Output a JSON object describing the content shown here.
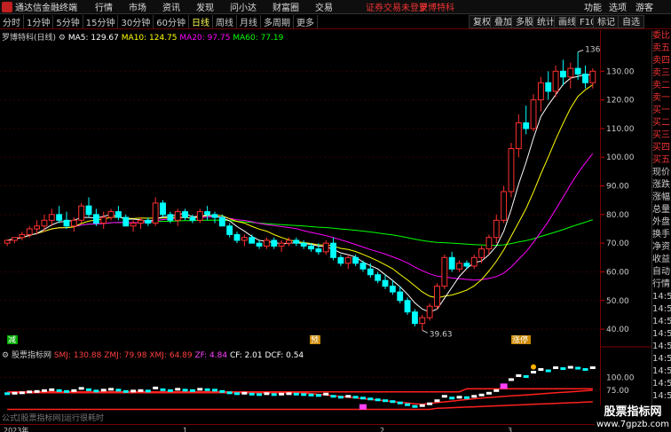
{
  "topbar": {
    "app_title": "通达信金融终端",
    "menus": [
      "行情",
      "市场",
      "资讯",
      "发现",
      "问小达",
      "财富圈",
      "交易"
    ],
    "notice": "证券交易未登录",
    "stock": "罗博特科",
    "right_menus": [
      "功能",
      "选项",
      "游客"
    ]
  },
  "periodbar": {
    "periods": [
      "分时",
      "1分钟",
      "5分钟",
      "15分钟",
      "30分钟",
      "60分钟",
      "日线",
      "周线",
      "月线",
      "多周期",
      "更多"
    ],
    "active": "日线",
    "tools": [
      "复权",
      "叠加",
      "多股",
      "统计",
      "画线",
      "F10",
      "标记",
      "自选"
    ]
  },
  "main_legend": {
    "title": "罗博特科(日线)",
    "ma5": "MA5: 129.67",
    "ma10": "MA10: 124.75",
    "ma20": "MA20: 97.75",
    "ma60": "MA60: 77.19",
    "colors": {
      "ma5": "#ffffff",
      "ma10": "#ffff00",
      "ma20": "#ff00ff",
      "ma60": "#00ff00",
      "up": "#ff3030",
      "down": "#00ffff"
    }
  },
  "main_annotations": {
    "high": "136.75",
    "low": "39.63",
    "markers": [
      "减",
      "预",
      "涨停"
    ]
  },
  "price_axis": [
    "130.00",
    "120.00",
    "110.00",
    "100.00",
    "90.00",
    "80.00",
    "70.00",
    "60.00",
    "50.00",
    "40.00"
  ],
  "ind_legend": {
    "title": "股票指标网",
    "smj": "SMJ: 130.88",
    "zmj": "ZMJ: 79.98",
    "xmj": "XMJ: 64.89",
    "zf": "ZF: 4.84",
    "cf": "CF: 2.01",
    "dcf": "DCF: 0.54"
  },
  "ind_axis": [
    "100.00",
    "75.00"
  ],
  "formula_note": "公式[股票指标网]运行很耗时",
  "date_axis": [
    "2023年",
    "1",
    "2",
    "3"
  ],
  "side_items": [
    "委比",
    "卖五",
    "卖四",
    "卖三",
    "卖二",
    "卖一",
    "买一",
    "买二",
    "买三",
    "买四",
    "买五",
    "现价",
    "涨跌",
    "涨幅",
    "总量",
    "外盘",
    "换手",
    "净资",
    "收益",
    "自动",
    "行情",
    "14:5",
    "14:5",
    "14:5",
    "14:5",
    "14:5",
    "14:5",
    "14:5",
    "14:5",
    "14:5"
  ],
  "watermark": {
    "line1": "股票指标网",
    "line2": "www.7gpzb.com"
  },
  "chart_data": {
    "type": "candlestick",
    "ylim": [
      36,
      140
    ],
    "candles": [
      [
        70,
        71,
        69,
        71
      ],
      [
        71,
        72,
        70,
        72
      ],
      [
        72,
        74,
        71,
        73
      ],
      [
        73,
        76,
        72,
        75
      ],
      [
        75,
        78,
        73,
        76
      ],
      [
        76,
        80,
        74,
        78
      ],
      [
        78,
        82,
        76,
        80
      ],
      [
        80,
        83,
        77,
        78
      ],
      [
        78,
        81,
        75,
        76
      ],
      [
        76,
        79,
        74,
        78
      ],
      [
        78,
        84,
        77,
        83
      ],
      [
        83,
        86,
        79,
        80
      ],
      [
        80,
        82,
        76,
        77
      ],
      [
        77,
        81,
        75,
        79
      ],
      [
        79,
        82,
        78,
        81
      ],
      [
        81,
        83,
        78,
        79
      ],
      [
        79,
        80,
        76,
        76
      ],
      [
        76,
        78,
        74,
        77
      ],
      [
        77,
        79,
        75,
        78
      ],
      [
        78,
        79,
        76,
        77
      ],
      [
        77,
        86,
        76,
        84
      ],
      [
        84,
        85,
        79,
        80
      ],
      [
        80,
        81,
        77,
        78
      ],
      [
        78,
        82,
        76,
        81
      ],
      [
        81,
        82,
        78,
        79
      ],
      [
        79,
        80,
        77,
        78
      ],
      [
        78,
        82,
        77,
        81
      ],
      [
        81,
        83,
        78,
        80
      ],
      [
        80,
        81,
        77,
        79
      ],
      [
        79,
        80,
        76,
        76
      ],
      [
        76,
        77,
        72,
        73
      ],
      [
        73,
        74,
        70,
        71
      ],
      [
        71,
        73,
        69,
        72
      ],
      [
        72,
        73,
        70,
        70
      ],
      [
        70,
        71,
        68,
        69
      ],
      [
        69,
        72,
        68,
        71
      ],
      [
        71,
        72,
        68,
        69
      ],
      [
        69,
        71,
        67,
        70
      ],
      [
        70,
        72,
        69,
        71
      ],
      [
        71,
        72,
        69,
        70
      ],
      [
        70,
        71,
        68,
        69
      ],
      [
        69,
        70,
        67,
        68
      ],
      [
        68,
        70,
        66,
        67
      ],
      [
        67,
        71,
        66,
        70
      ],
      [
        70,
        72,
        64,
        65
      ],
      [
        65,
        66,
        62,
        63
      ],
      [
        63,
        66,
        61,
        65
      ],
      [
        65,
        66,
        62,
        63
      ],
      [
        63,
        64,
        60,
        61
      ],
      [
        61,
        63,
        58,
        59
      ],
      [
        59,
        60,
        56,
        57
      ],
      [
        57,
        59,
        54,
        55
      ],
      [
        55,
        57,
        52,
        53
      ],
      [
        53,
        55,
        49,
        50
      ],
      [
        50,
        51,
        45,
        46
      ],
      [
        46,
        47,
        41,
        42
      ],
      [
        42,
        45,
        39.63,
        44
      ],
      [
        44,
        49,
        43,
        48
      ],
      [
        48,
        56,
        47,
        55
      ],
      [
        55,
        66,
        54,
        65
      ],
      [
        65,
        67,
        60,
        61
      ],
      [
        61,
        64,
        60,
        63
      ],
      [
        63,
        64,
        61,
        62
      ],
      [
        62,
        66,
        61,
        65
      ],
      [
        65,
        69,
        63,
        68
      ],
      [
        68,
        73,
        66,
        72
      ],
      [
        72,
        80,
        70,
        78
      ],
      [
        78,
        90,
        77,
        88
      ],
      [
        88,
        105,
        86,
        103
      ],
      [
        103,
        115,
        100,
        112
      ],
      [
        112,
        118,
        108,
        110
      ],
      [
        110,
        122,
        109,
        120
      ],
      [
        120,
        128,
        116,
        126
      ],
      [
        126,
        130,
        120,
        123
      ],
      [
        123,
        132,
        121,
        130
      ],
      [
        130,
        134,
        125,
        128
      ],
      [
        128,
        133,
        124,
        131
      ],
      [
        131,
        136.75,
        127,
        129
      ],
      [
        129,
        132,
        124,
        126
      ],
      [
        126,
        131,
        124,
        130
      ]
    ]
  }
}
